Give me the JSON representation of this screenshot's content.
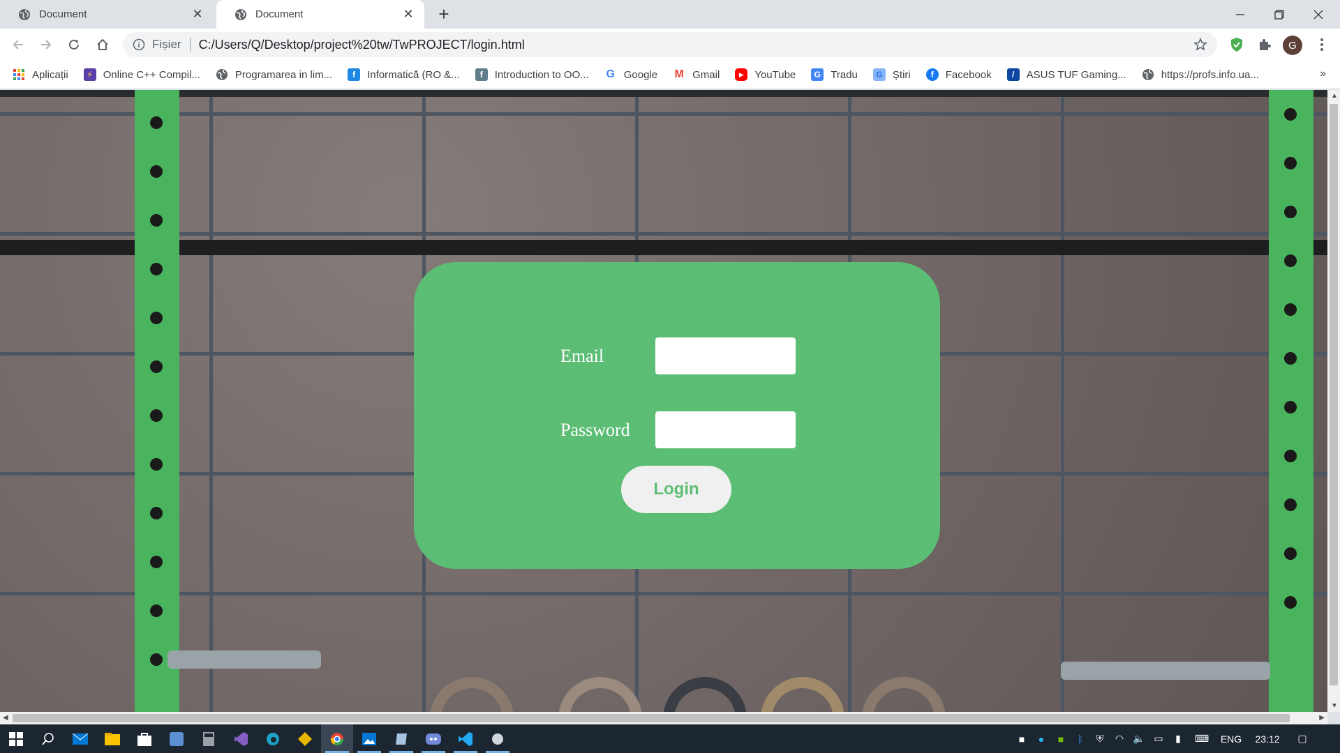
{
  "browser": {
    "tabs": [
      {
        "title": "Document",
        "active": false
      },
      {
        "title": "Document",
        "active": true
      }
    ],
    "address": {
      "security_label": "Fișier",
      "url": "C:/Users/Q/Desktop/project%20tw/TwPROJECT/login.html"
    },
    "avatar_letter": "G",
    "bookmarks": [
      {
        "label": "Aplicații",
        "icon": "apps-grid-icon"
      },
      {
        "label": "Online C++ Compil...",
        "icon": "bolt-icon"
      },
      {
        "label": "Programarea in lim...",
        "icon": "globe-icon"
      },
      {
        "label": "Informatică (RO &...",
        "icon": "site-icon"
      },
      {
        "label": "Introduction to OO...",
        "icon": "site-icon"
      },
      {
        "label": "Google",
        "icon": "google-icon"
      },
      {
        "label": "Gmail",
        "icon": "gmail-icon"
      },
      {
        "label": "YouTube",
        "icon": "youtube-icon"
      },
      {
        "label": "Tradu",
        "icon": "translate-icon"
      },
      {
        "label": "Știri",
        "icon": "news-icon"
      },
      {
        "label": "Facebook",
        "icon": "facebook-icon"
      },
      {
        "label": "ASUS TUF Gaming...",
        "icon": "asus-icon"
      },
      {
        "label": "https://profs.info.ua...",
        "icon": "globe-icon"
      }
    ],
    "bookmarks_overflow": "»"
  },
  "page": {
    "form": {
      "email_label": "Email",
      "password_label": "Password",
      "email_value": "",
      "password_value": "",
      "login_label": "Login"
    },
    "colors": {
      "card": "#5cbd74",
      "button_bg": "#f0f0f0",
      "button_text": "#5cbd74"
    }
  },
  "taskbar": {
    "language": "ENG",
    "time": "23:12"
  }
}
